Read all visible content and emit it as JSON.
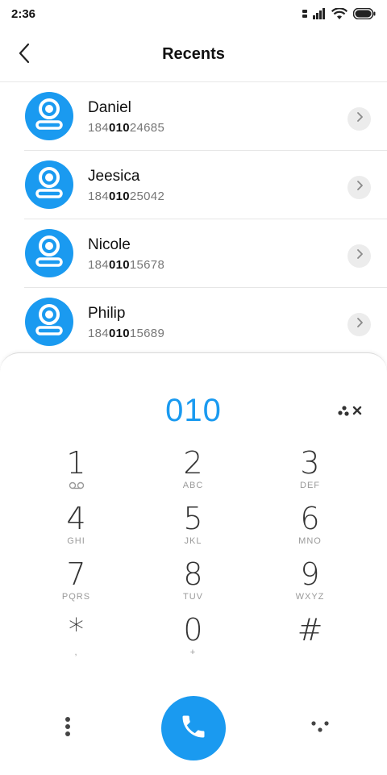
{
  "status_bar": {
    "time": "2:36",
    "icons": [
      "sim-icon",
      "signal-icon",
      "wifi-icon",
      "battery-icon"
    ]
  },
  "header": {
    "title": "Recents",
    "back_icon": "chevron-left-icon"
  },
  "contacts": [
    {
      "name": "Daniel",
      "number_prefix": "184",
      "number_match": "010",
      "number_suffix": "24685"
    },
    {
      "name": "Jeesica",
      "number_prefix": "184",
      "number_match": "010",
      "number_suffix": "25042"
    },
    {
      "name": "Nicole",
      "number_prefix": "184",
      "number_match": "010",
      "number_suffix": "15678"
    },
    {
      "name": "Philip",
      "number_prefix": "184",
      "number_match": "010",
      "number_suffix": "15689"
    }
  ],
  "dialer": {
    "input_value": "010",
    "keys": [
      {
        "digit": "1",
        "letters": ""
      },
      {
        "digit": "2",
        "letters": "ABC"
      },
      {
        "digit": "3",
        "letters": "DEF"
      },
      {
        "digit": "4",
        "letters": "GHI"
      },
      {
        "digit": "5",
        "letters": "JKL"
      },
      {
        "digit": "6",
        "letters": "MNO"
      },
      {
        "digit": "7",
        "letters": "PQRS"
      },
      {
        "digit": "8",
        "letters": "TUV"
      },
      {
        "digit": "9",
        "letters": "WXYZ"
      },
      {
        "digit": "*",
        "letters": ","
      },
      {
        "digit": "0",
        "letters": "+"
      },
      {
        "digit": "#",
        "letters": ""
      }
    ]
  },
  "colors": {
    "accent": "#1a9af0",
    "text_primary": "#111111",
    "text_secondary": "#777777",
    "key_digit": "#333333",
    "key_letters": "#9a9a9a"
  }
}
